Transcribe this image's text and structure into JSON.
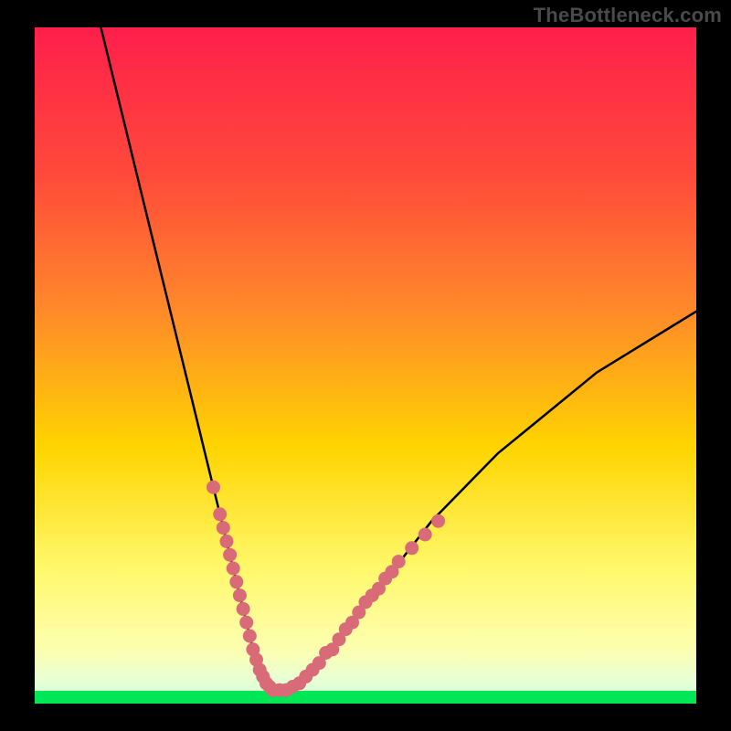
{
  "watermark": "TheBottleneck.com",
  "colors": {
    "bg": "#000000",
    "watermark": "#4a4a4a",
    "curve": "#000000",
    "marker_fill": "#d96b78",
    "marker_stroke": "#d96b78",
    "band_bottom": "#00e756",
    "gradient_top": "#ff1f4b",
    "gradient_mid1": "#ff7a2a",
    "gradient_mid2": "#ffd400",
    "gradient_low": "#fff86b"
  },
  "chart_data": {
    "type": "line",
    "title": "",
    "xlabel": "",
    "ylabel": "",
    "xlim": [
      0,
      100
    ],
    "ylim": [
      0,
      100
    ],
    "grid": false,
    "legend": false,
    "series": [
      {
        "name": "bottleneck-curve",
        "x": [
          10,
          12,
          14,
          16,
          18,
          20,
          22,
          24,
          26,
          28,
          30,
          31,
          32,
          33,
          34,
          35,
          36,
          38,
          40,
          42,
          45,
          48,
          52,
          56,
          60,
          65,
          70,
          75,
          80,
          85,
          90,
          95,
          100
        ],
        "values": [
          100,
          92,
          84,
          76,
          68,
          60,
          52,
          44,
          36,
          28,
          20,
          16,
          12,
          8,
          5,
          3,
          2,
          2,
          3,
          5,
          8,
          12,
          17,
          22,
          27,
          32,
          37,
          41,
          45,
          49,
          52,
          55,
          58
        ]
      }
    ],
    "markers": [
      {
        "x": 27,
        "y": 32
      },
      {
        "x": 28,
        "y": 28
      },
      {
        "x": 28.5,
        "y": 26
      },
      {
        "x": 29,
        "y": 24
      },
      {
        "x": 29.5,
        "y": 22
      },
      {
        "x": 30,
        "y": 20
      },
      {
        "x": 30.5,
        "y": 18
      },
      {
        "x": 31,
        "y": 16
      },
      {
        "x": 31.5,
        "y": 14
      },
      {
        "x": 32,
        "y": 12
      },
      {
        "x": 32.5,
        "y": 10
      },
      {
        "x": 33,
        "y": 8
      },
      {
        "x": 33.5,
        "y": 6.5
      },
      {
        "x": 34,
        "y": 5
      },
      {
        "x": 34.5,
        "y": 4
      },
      {
        "x": 35,
        "y": 3
      },
      {
        "x": 35.5,
        "y": 2.5
      },
      {
        "x": 36,
        "y": 2
      },
      {
        "x": 37,
        "y": 2
      },
      {
        "x": 38,
        "y": 2
      },
      {
        "x": 39,
        "y": 2.5
      },
      {
        "x": 40,
        "y": 3
      },
      {
        "x": 41,
        "y": 4
      },
      {
        "x": 42,
        "y": 5
      },
      {
        "x": 43,
        "y": 6
      },
      {
        "x": 44,
        "y": 7.5
      },
      {
        "x": 45,
        "y": 8
      },
      {
        "x": 46,
        "y": 9.5
      },
      {
        "x": 47,
        "y": 11
      },
      {
        "x": 48,
        "y": 12
      },
      {
        "x": 49,
        "y": 13.5
      },
      {
        "x": 50,
        "y": 15
      },
      {
        "x": 51,
        "y": 16
      },
      {
        "x": 52,
        "y": 17
      },
      {
        "x": 53,
        "y": 18.5
      },
      {
        "x": 54,
        "y": 19.5
      },
      {
        "x": 55,
        "y": 21
      },
      {
        "x": 57,
        "y": 23
      },
      {
        "x": 59,
        "y": 25
      },
      {
        "x": 61,
        "y": 27
      }
    ]
  }
}
